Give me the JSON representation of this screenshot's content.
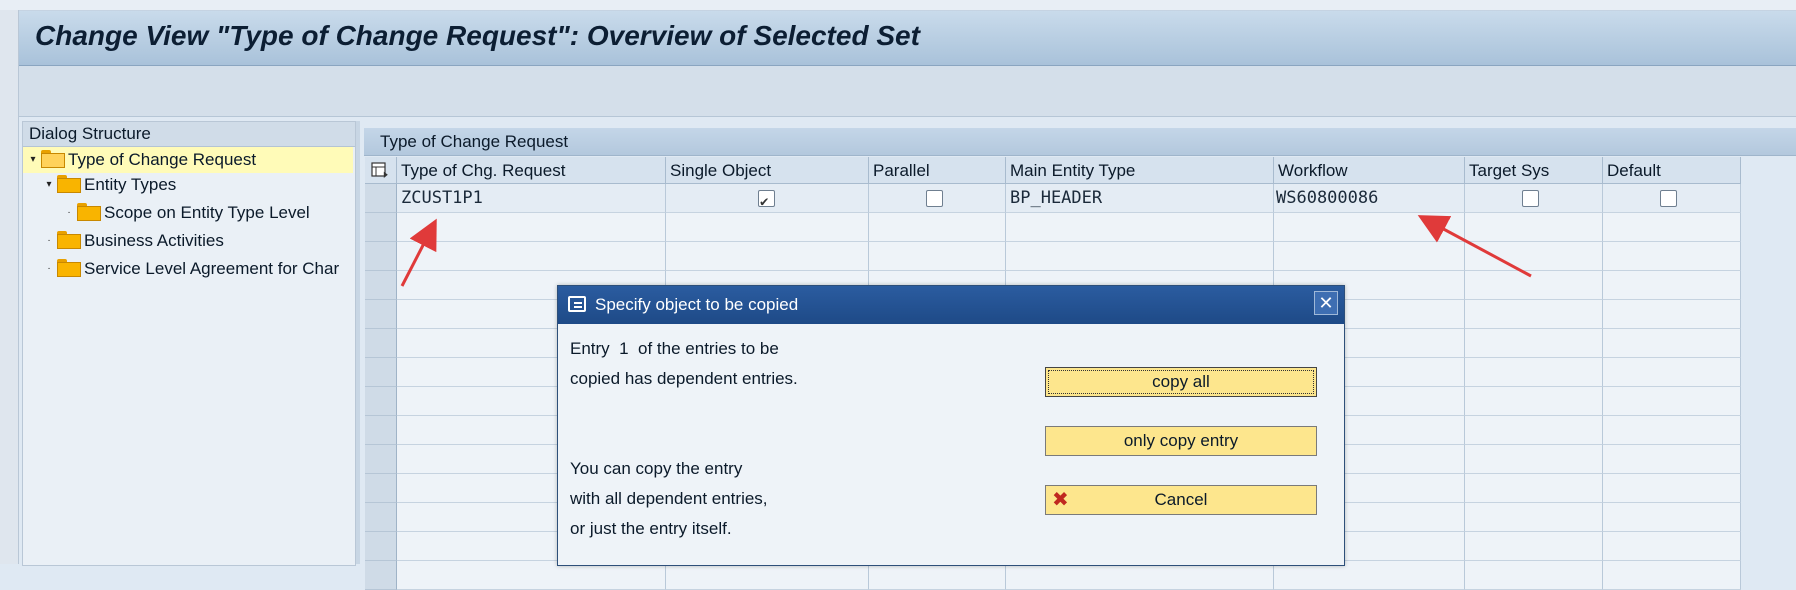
{
  "window": {
    "title": "Change View \"Type of Change Request\": Overview of Selected Set"
  },
  "dialog_structure": {
    "header": "Dialog Structure",
    "items": [
      {
        "label": "Type of Change Request",
        "toggle": "▾",
        "selected": true
      },
      {
        "label": "Entity Types",
        "toggle": "▾"
      },
      {
        "label": "Scope on Entity Type Level",
        "toggle": "·"
      },
      {
        "label": "Business Activities",
        "toggle": "·"
      },
      {
        "label": "Service Level Agreement for Char",
        "toggle": "·"
      }
    ]
  },
  "table": {
    "title": "Type of Change Request",
    "columns": [
      "Type of Chg. Request",
      "Single Object",
      "Parallel",
      "Main Entity Type",
      "Workflow",
      "Target Sys",
      "Default"
    ],
    "rows": [
      {
        "type": "ZCUST1P1",
        "single_object": true,
        "parallel": false,
        "main_entity_type": "BP_HEADER",
        "workflow": "WS60800086",
        "target_sys": false,
        "default": false
      }
    ]
  },
  "dialog": {
    "title": "Specify object to be copied",
    "message_line1": "Entry  1  of the entries to be",
    "message_line2": "copied has dependent entries.",
    "info_line1": "You can copy the entry",
    "info_line2": "with all dependent entries,",
    "info_line3": "or just the entry itself.",
    "btn_copy_all": "copy all",
    "btn_only_copy": "only copy entry",
    "btn_cancel": "Cancel",
    "close_symbol": "✕"
  },
  "colors": {
    "accent": "#1e4a87",
    "button": "#fde68d",
    "annotation_arrow": "#e03a3a",
    "selected_item": "#fffbb8"
  },
  "icons": [
    "folder-icon",
    "folder-open-icon",
    "table-settings-icon",
    "dialog-icon",
    "close-icon",
    "cancel-x-icon",
    "checkbox"
  ]
}
